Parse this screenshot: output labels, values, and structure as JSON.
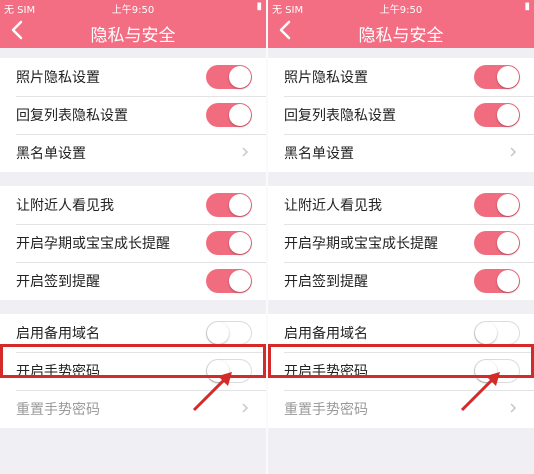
{
  "status": {
    "carrier": "无 SIM",
    "time": "上午9:50"
  },
  "nav": {
    "title": "隐私与安全"
  },
  "groups": [
    {
      "items": [
        {
          "label": "照片隐私设置",
          "control": "toggle",
          "on": true
        },
        {
          "label": "回复列表隐私设置",
          "control": "toggle",
          "on": true
        },
        {
          "label": "黑名单设置",
          "control": "chevron"
        }
      ]
    },
    {
      "items": [
        {
          "label": "让附近人看见我",
          "control": "toggle",
          "on": true
        },
        {
          "label": "开启孕期或宝宝成长提醒",
          "control": "toggle",
          "on": true
        },
        {
          "label": "开启签到提醒",
          "control": "toggle",
          "on": true
        }
      ]
    },
    {
      "items": [
        {
          "label": "启用备用域名",
          "control": "toggle",
          "on": false
        },
        {
          "label": "开启手势密码",
          "control": "toggle",
          "on": false
        },
        {
          "label": "重置手势密码",
          "control": "chevron",
          "disabled": true
        }
      ]
    }
  ],
  "colors": {
    "accent": "#f36d83",
    "toggle_on": "#f26c80",
    "highlight": "#d42a2a"
  }
}
